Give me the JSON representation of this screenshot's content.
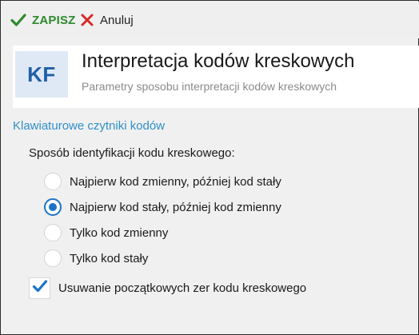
{
  "toolbar": {
    "save_label": "ZAPISZ",
    "cancel_label": "Anuluj"
  },
  "header": {
    "badge": "KF",
    "title": "Interpretacja kodów kreskowych",
    "subtitle": "Parametry sposobu interpretacji kodów kreskowych"
  },
  "section": {
    "title": "Klawiaturowe czytniki kodów",
    "question": "Sposób identyfikacji kodu kreskowego:",
    "options": [
      {
        "label": "Najpierw kod zmienny, później kod stały",
        "selected": false
      },
      {
        "label": "Najpierw kod stały, później kod zmienny",
        "selected": true
      },
      {
        "label": "Tylko kod zmienny",
        "selected": false
      },
      {
        "label": "Tylko kod stały",
        "selected": false
      }
    ],
    "checkbox": {
      "label": "Usuwanie początkowych zer kodu kreskowego",
      "checked": true
    }
  },
  "colors": {
    "save_green": "#2d8a2d",
    "cancel_red": "#d62a2a",
    "accent_blue": "#1b73c7",
    "section_blue": "#2f8fc8",
    "badge_bg": "#dfe9f5",
    "badge_text": "#1f5fa8"
  },
  "icons": {
    "save": "checkmark-icon",
    "cancel": "x-icon",
    "checkbox": "checkmark-icon"
  }
}
